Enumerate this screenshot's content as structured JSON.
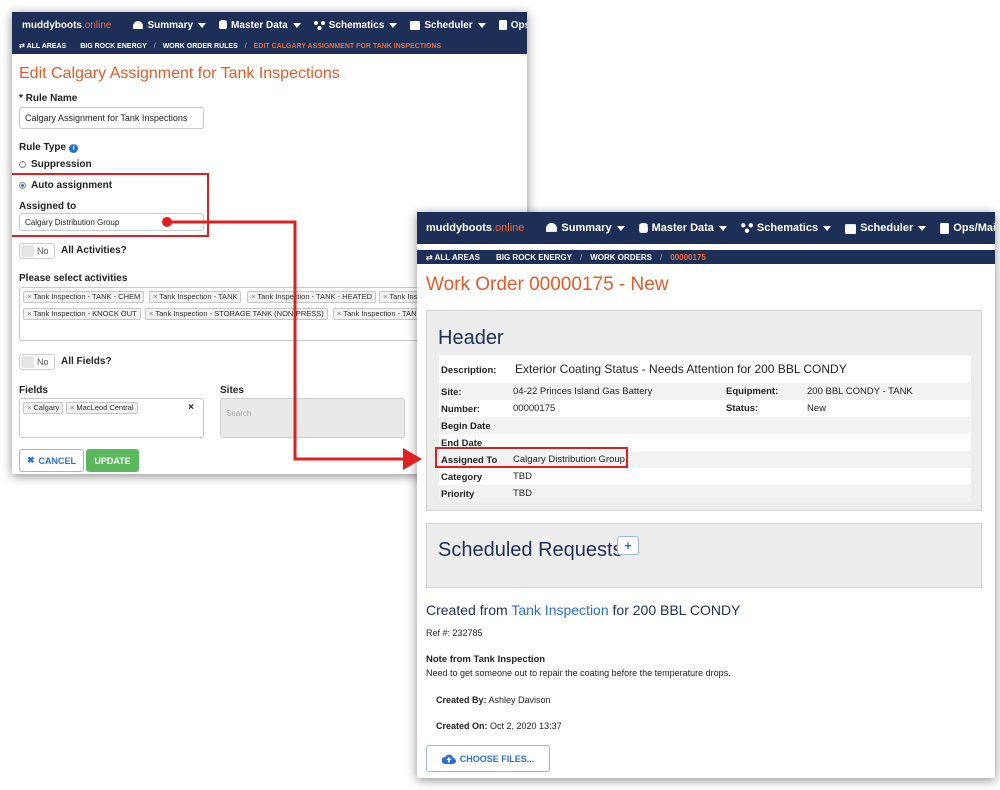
{
  "left": {
    "nav": {
      "logo": "muddyboots",
      "logo_suffix": ".online",
      "menu": [
        "Summary",
        "Master Data",
        "Schematics",
        "Scheduler",
        "Ops/Maintenance"
      ]
    },
    "breadcrumb": [
      "ALL AREAS",
      "BIG ROCK ENERGY",
      "WORK ORDER RULES",
      "EDIT CALGARY ASSIGNMENT FOR TANK INSPECTIONS"
    ],
    "page_title": "Edit Calgary Assignment for Tank Inspections",
    "rule_name_label": "* Rule Name",
    "rule_name_value": "Calgary Assignment for Tank Inspections",
    "rule_type_label": "Rule Type",
    "option_suppression": "Suppression",
    "option_auto": "Auto assignment",
    "assigned_to_label": "Assigned to",
    "assigned_to_value": "Calgary Distribution Group",
    "toggle_no": "No",
    "all_activities_label": "All Activities?",
    "activities_label": "Please select activities",
    "activities": [
      "Tank Inspection - TANK - CHEM",
      "Tank Inspection - TANK",
      "Tank Inspection - TANK - HEATED",
      "Tank Ins",
      "Tank Inspection - KNOCK OUT",
      "Tank Inspection - STORAGE TANK (NON-PRESS)",
      "Tank Inspection - TAN"
    ],
    "all_fields_label": "All Fields?",
    "fields_label": "Fields",
    "fields": [
      "Calgary",
      "MacLeod Central"
    ],
    "clear_icon": "×",
    "sites_label": "Sites",
    "sites_placeholder": "Search",
    "cancel_label": "CANCEL",
    "update_label": "UPDATE"
  },
  "right": {
    "nav": {
      "logo": "muddyboots",
      "logo_suffix": ".online",
      "menu": [
        "Summary",
        "Master Data",
        "Schematics",
        "Scheduler",
        "Ops/Maintenance"
      ]
    },
    "breadcrumb": [
      "ALL AREAS",
      "BIG ROCK ENERGY",
      "WORK ORDERS",
      "00000175"
    ],
    "page_title": "Work Order 00000175 - New",
    "header_title": "Header",
    "description_label": "Description:",
    "description_value": "Exterior Coating Status - Needs Attention for 200 BBL CONDY",
    "rows": [
      {
        "label": "Site:",
        "value": "04-22 Princes Island Gas Battery",
        "label2": "Equipment:",
        "value2": "200 BBL CONDY - TANK"
      },
      {
        "label": "Number:",
        "value": "00000175",
        "label2": "Status:",
        "value2": "New"
      },
      {
        "label": "Begin Date",
        "value": ""
      },
      {
        "label": "End Date",
        "value": ""
      },
      {
        "label": "Assigned To",
        "value": "Calgary Distribution Group"
      },
      {
        "label": "Category",
        "value": "TBD"
      },
      {
        "label": "Priority",
        "value": "TBD"
      }
    ],
    "scheduled_title": "Scheduled Requests",
    "add_label": "+",
    "created_prefix": "Created from",
    "created_link": "Tank Inspection",
    "created_suffix": "for 200 BBL CONDY",
    "ref": "Ref #: 232785",
    "note_title": "Note from Tank Inspection",
    "note_text": "Need to get someone out to repair the coating before the temperature drops.",
    "created_by_label": "Created By:",
    "created_by_value": "Ashley Davison",
    "created_on_label": "Created On:",
    "created_on_value": "Oct 2, 2020 13:37",
    "choose_files_label": "CHOOSE FILES..."
  },
  "colors": {
    "nav": "#1d2f56",
    "title_orange": "#e55a26",
    "highlight_red": "#e02020",
    "update_green": "#5cb85c",
    "link_blue": "#2a6fd8"
  }
}
